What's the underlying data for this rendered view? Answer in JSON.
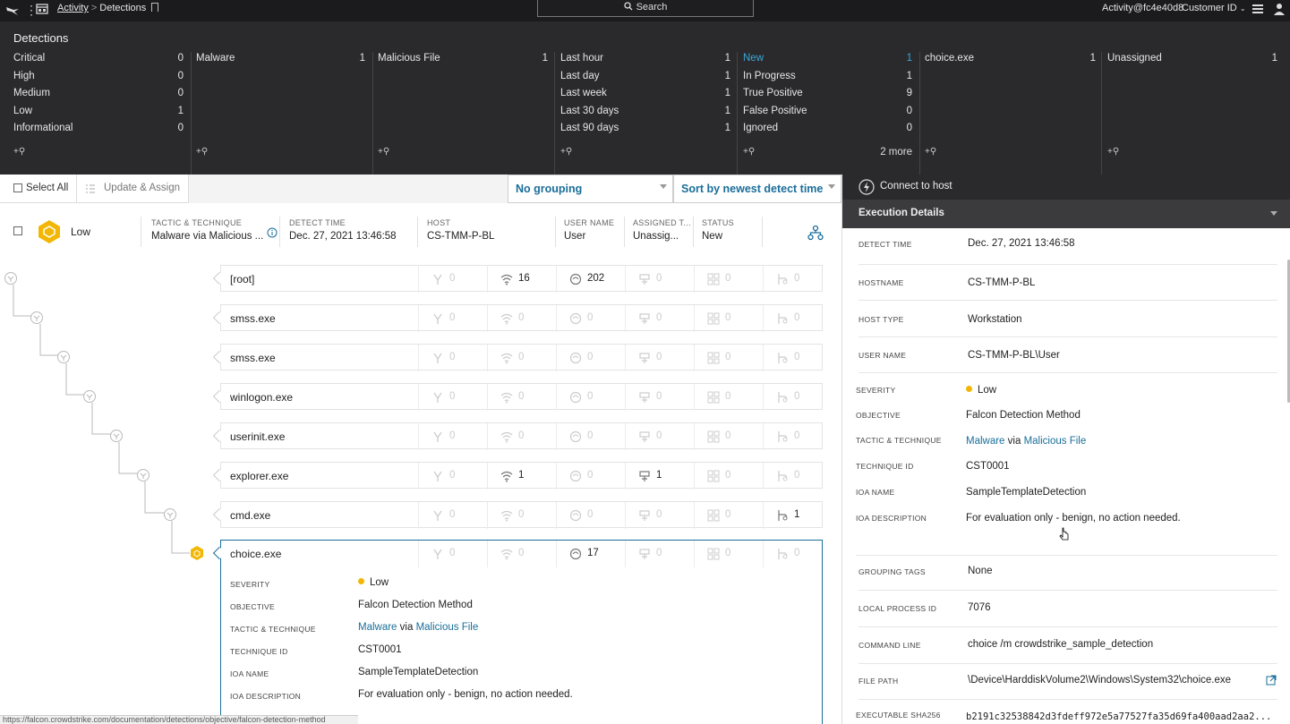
{
  "topbar": {
    "breadcrumb_root": "Activity",
    "breadcrumb_current": "Detections",
    "search_label": "Search",
    "user": "Activity@fc4e40d8",
    "customer": "Customer ID"
  },
  "filters": {
    "title": "Detections",
    "severity": [
      {
        "label": "Critical",
        "count": "0"
      },
      {
        "label": "High",
        "count": "0"
      },
      {
        "label": "Medium",
        "count": "0"
      },
      {
        "label": "Low",
        "count": "1"
      },
      {
        "label": "Informational",
        "count": "0"
      }
    ],
    "tactic": [
      {
        "label": "Malware",
        "count": "1"
      }
    ],
    "technique": [
      {
        "label": "Malicious File",
        "count": "1"
      }
    ],
    "time": [
      {
        "label": "Last hour",
        "count": "1"
      },
      {
        "label": "Last day",
        "count": "1"
      },
      {
        "label": "Last week",
        "count": "1"
      },
      {
        "label": "Last 30 days",
        "count": "1"
      },
      {
        "label": "Last 90 days",
        "count": "1"
      }
    ],
    "status": [
      {
        "label": "New",
        "count": "1"
      },
      {
        "label": "In Progress",
        "count": "1"
      },
      {
        "label": "True Positive",
        "count": "9"
      },
      {
        "label": "False Positive",
        "count": "0"
      },
      {
        "label": "Ignored",
        "count": "0"
      }
    ],
    "status_more": "2 more",
    "file": [
      {
        "label": "choice.exe",
        "count": "1"
      }
    ],
    "assignee": [
      {
        "label": "Unassigned",
        "count": "1"
      }
    ],
    "add_label": "+⚲"
  },
  "toolbar": {
    "select_all": "Select All",
    "update_assign": "Update & Assign",
    "grouping": "No grouping",
    "sort": "Sort by newest detect time"
  },
  "detection": {
    "severity": "Low",
    "tactic_header": "TACTIC & TECHNIQUE",
    "tactic_value": "Malware via Malicious ...",
    "time_header": "DETECT TIME",
    "time_value": "Dec. 27, 2021 13:46:58",
    "host_header": "HOST",
    "host_value": "CS-TMM-P-BL",
    "user_header": "USER NAME",
    "user_value": "User",
    "assigned_header": "ASSIGNED T...",
    "assigned_value": "Unassig...",
    "status_header": "STATUS",
    "status_value": "New"
  },
  "processes": [
    {
      "name": "[root]",
      "counts": [
        "0",
        "16",
        "202",
        "0",
        "0",
        "0"
      ],
      "active": [
        false,
        true,
        true,
        false,
        false,
        false
      ]
    },
    {
      "name": "smss.exe",
      "counts": [
        "0",
        "0",
        "0",
        "0",
        "0",
        "0"
      ],
      "active": [
        false,
        false,
        false,
        false,
        false,
        false
      ]
    },
    {
      "name": "smss.exe",
      "counts": [
        "0",
        "0",
        "0",
        "0",
        "0",
        "0"
      ],
      "active": [
        false,
        false,
        false,
        false,
        false,
        false
      ]
    },
    {
      "name": "winlogon.exe",
      "counts": [
        "0",
        "0",
        "0",
        "0",
        "0",
        "0"
      ],
      "active": [
        false,
        false,
        false,
        false,
        false,
        false
      ]
    },
    {
      "name": "userinit.exe",
      "counts": [
        "0",
        "0",
        "0",
        "0",
        "0",
        "0"
      ],
      "active": [
        false,
        false,
        false,
        false,
        false,
        false
      ]
    },
    {
      "name": "explorer.exe",
      "counts": [
        "0",
        "1",
        "0",
        "1",
        "0",
        "0"
      ],
      "active": [
        false,
        true,
        false,
        true,
        false,
        false
      ]
    },
    {
      "name": "cmd.exe",
      "counts": [
        "0",
        "0",
        "0",
        "0",
        "0",
        "1"
      ],
      "active": [
        false,
        false,
        false,
        false,
        false,
        true
      ]
    }
  ],
  "selected_process": {
    "name": "choice.exe",
    "counts": [
      "0",
      "0",
      "17",
      "0",
      "0",
      "0"
    ],
    "active": [
      false,
      false,
      true,
      false,
      false,
      false
    ],
    "severity_key": "SEVERITY",
    "severity": "Low",
    "objective_key": "OBJECTIVE",
    "objective": "Falcon Detection Method",
    "tactic_key": "TACTIC & TECHNIQUE",
    "tactic": "Malware",
    "via": "via",
    "technique": "Malicious File",
    "technique_id_key": "TECHNIQUE ID",
    "technique_id": "CST0001",
    "ioa_name_key": "IOA NAME",
    "ioa_name": "SampleTemplateDetection",
    "ioa_desc_key": "IOA DESCRIPTION",
    "ioa_desc": "For evaluation only - benign, no action needed."
  },
  "status_url": "https://falcon.crowdstrike.com/documentation/detections/objective/falcon-detection-method",
  "panel": {
    "connect": "Connect to host",
    "section": "Execution Details",
    "detect_time_key": "DETECT TIME",
    "detect_time": "Dec. 27, 2021 13:46:58",
    "hostname_key": "HOSTNAME",
    "hostname": "CS-TMM-P-BL",
    "host_type_key": "HOST TYPE",
    "host_type": "Workstation",
    "user_name_key": "USER NAME",
    "user_name": "CS-TMM-P-BL\\User",
    "severity_key": "SEVERITY",
    "severity": "Low",
    "objective_key": "OBJECTIVE",
    "objective": "Falcon Detection Method",
    "tactic_key": "TACTIC & TECHNIQUE",
    "tactic": "Malware",
    "via": "via",
    "technique": "Malicious File",
    "technique_id_key": "TECHNIQUE ID",
    "technique_id": "CST0001",
    "ioa_name_key": "IOA NAME",
    "ioa_name": "SampleTemplateDetection",
    "ioa_desc_key": "IOA DESCRIPTION",
    "ioa_desc": "For evaluation only - benign, no action needed.",
    "grouping_key": "GROUPING TAGS",
    "grouping": "None",
    "pid_key": "LOCAL PROCESS ID",
    "pid": "7076",
    "cmd_key": "COMMAND LINE",
    "cmd": "choice /m crowdstrike_sample_detection",
    "path_key": "FILE PATH",
    "path": "\\Device\\HarddiskVolume2\\Windows\\System32\\choice.exe",
    "sha_key": "EXECUTABLE SHA256",
    "sha": "b2191c32538842d3fdeff972e5a77527fa35d69fa400aad2aa2..."
  },
  "colors": {
    "accent": "#1a6e9a",
    "severity_low": "#f2b705",
    "topbar": "#1b1b1d",
    "filters_bg": "#2a2a2c"
  }
}
